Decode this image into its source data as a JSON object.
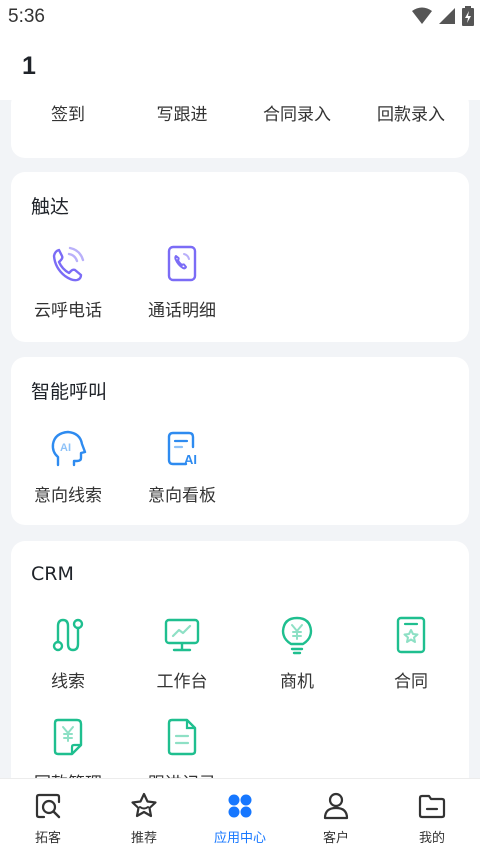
{
  "status": {
    "time": "5:36"
  },
  "header": {
    "title": "1"
  },
  "quick_actions": [
    "签到",
    "写跟进",
    "合同录入",
    "回款录入"
  ],
  "sections": {
    "reach": {
      "title": "触达",
      "items": [
        "云呼电话",
        "通话明细"
      ]
    },
    "smart_call": {
      "title": "智能呼叫",
      "items": [
        "意向线索",
        "意向看板"
      ]
    },
    "crm": {
      "title": "CRM",
      "items": [
        "线索",
        "工作台",
        "商机",
        "合同",
        "回款管理",
        "跟进记录"
      ]
    }
  },
  "tabs": [
    {
      "label": "拓客",
      "icon": "search-box-icon"
    },
    {
      "label": "推荐",
      "icon": "star-icon"
    },
    {
      "label": "应用中心",
      "icon": "app-grid-icon"
    },
    {
      "label": "客户",
      "icon": "person-icon"
    },
    {
      "label": "我的",
      "icon": "folder-icon"
    }
  ],
  "colors": {
    "accent": "#1677ff",
    "purple": "#7b6cf6",
    "teal": "#1fbf8f",
    "blue_icon": "#2e8bf0"
  }
}
